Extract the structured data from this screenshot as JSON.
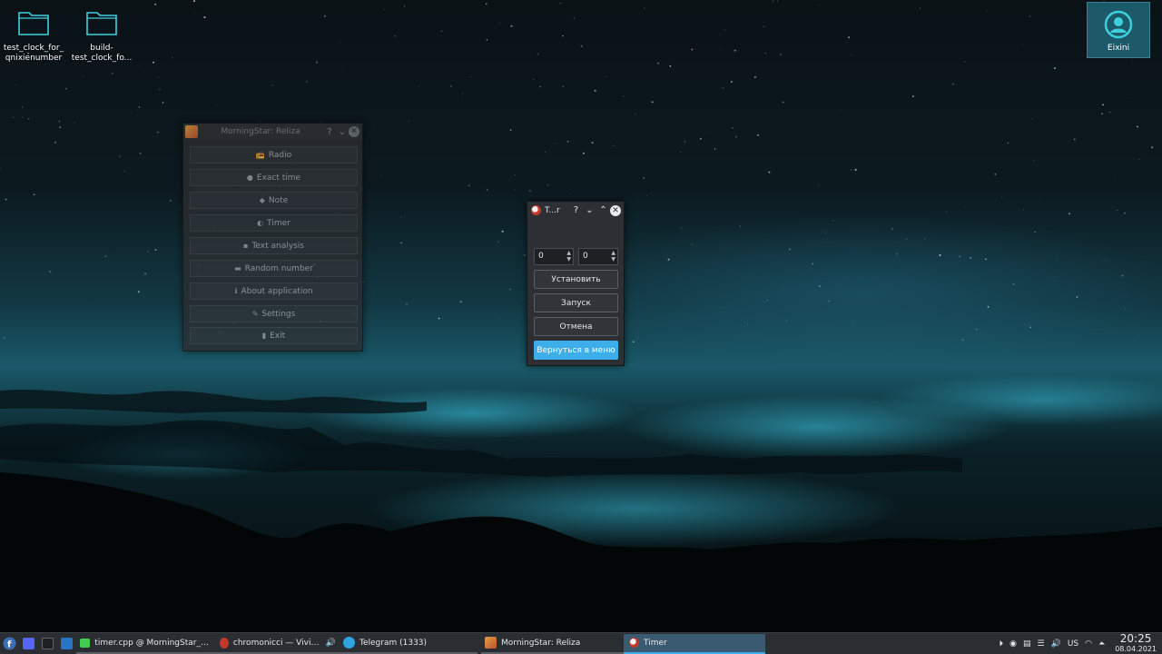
{
  "desktop": {
    "icons": [
      {
        "label_line1": "test_clock_for_",
        "label_line2": "qnixienumber"
      },
      {
        "label_line1": "build-",
        "label_line2": "test_clock_fo..."
      }
    ],
    "user": {
      "name": "Eixini"
    }
  },
  "morningstar": {
    "title": "MorningStar: Reliza",
    "help": "?",
    "minimize": "⌄",
    "close": "✕",
    "buttons": [
      {
        "label": "Radio",
        "icon": "📻"
      },
      {
        "label": "Exact time",
        "icon": "●"
      },
      {
        "label": "Note",
        "icon": "◆"
      },
      {
        "label": "Timer",
        "icon": "◐"
      },
      {
        "label": "Text analysis",
        "icon": "▪"
      },
      {
        "label": "Random number",
        "icon": "▬"
      },
      {
        "label": "About application",
        "icon": "ℹ"
      },
      {
        "label": "Settings",
        "icon": "✎"
      },
      {
        "label": "Exit",
        "icon": "▮"
      }
    ]
  },
  "timer": {
    "title": "T...r",
    "help": "?",
    "minimize": "⌄",
    "maximize": "⌃",
    "close": "✕",
    "spin1_value": "0",
    "spin2_value": "0",
    "set_label": "Установить",
    "start_label": "Запуск",
    "cancel_label": "Отмена",
    "back_label": "Вернуться в меню"
  },
  "taskbar": {
    "tasks": [
      {
        "label": "timer.cpp @ MorningStar_Re..."
      },
      {
        "label": "chromonicci — Vivid. — ..."
      },
      {
        "label": "Telegram (1333)"
      },
      {
        "label": "MorningStar: Reliza"
      },
      {
        "label": "Timer"
      }
    ],
    "telegram_badge": "1333",
    "keyboard_layout": "US",
    "time": "20:25",
    "date": "08.04.2021"
  },
  "colors": {
    "accent": "#3daee9",
    "panel": "#2a2e32"
  }
}
